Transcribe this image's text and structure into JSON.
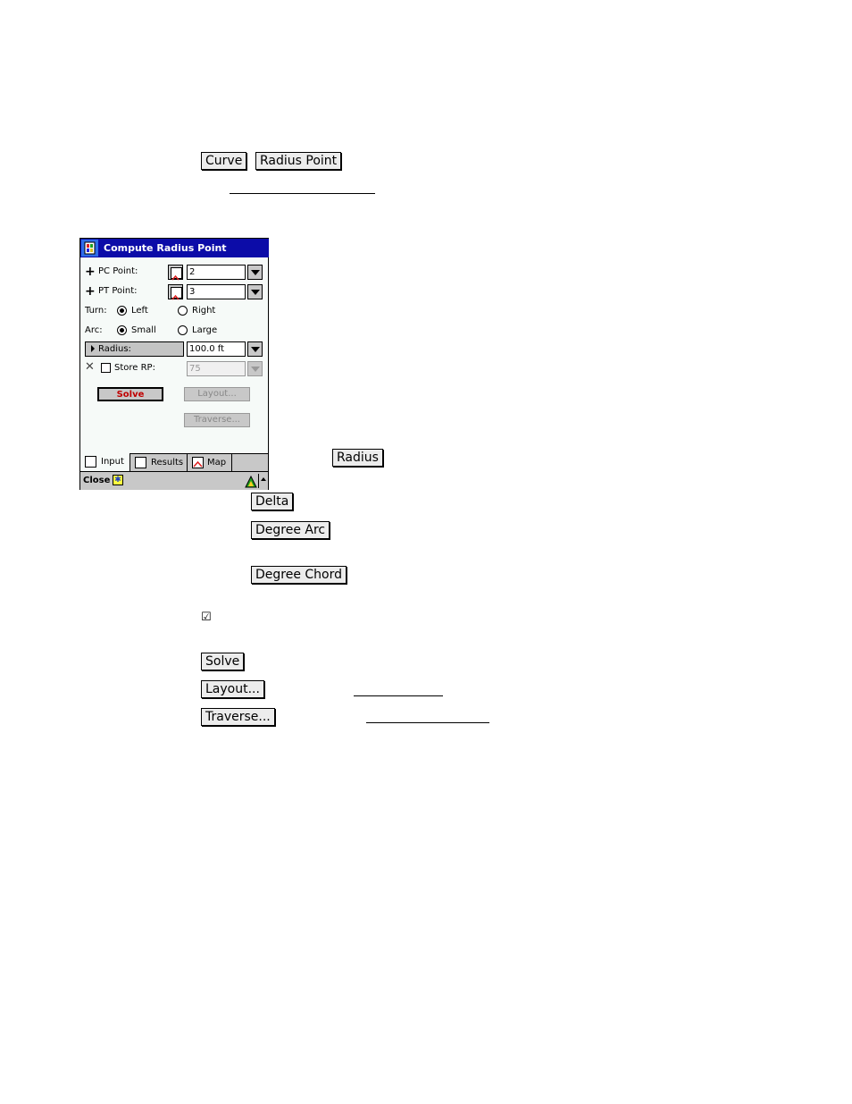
{
  "doc": {
    "inline_buttons": {
      "curve": "Curve",
      "radius_point": "Radius Point",
      "radius": "Radius",
      "delta": "Delta",
      "degree_arc": "Degree Arc",
      "degree_chord": "Degree Chord",
      "solve": "Solve",
      "layout": "Layout...",
      "traverse": "Traverse..."
    },
    "checkbox_glyph": "☑"
  },
  "dialog": {
    "title": "Compute Radius Point",
    "pc_point": {
      "label": "PC Point:",
      "value": "2"
    },
    "pt_point": {
      "label": "PT Point:",
      "value": "3"
    },
    "turn": {
      "label": "Turn:",
      "options": [
        "Left",
        "Right"
      ],
      "selected": "Left"
    },
    "arc": {
      "label": "Arc:",
      "options": [
        "Small",
        "Large"
      ],
      "selected": "Small"
    },
    "radius": {
      "label": "Radius:",
      "value": "100.0 ft"
    },
    "store_rp": {
      "label": "Store RP:",
      "checked": false,
      "value": "75"
    },
    "buttons": {
      "solve": "Solve",
      "layout": "Layout...",
      "traverse": "Traverse..."
    },
    "tabs": [
      {
        "label": "Input",
        "icon": "input-form-icon",
        "active": true
      },
      {
        "label": "Results",
        "icon": "results-doc-icon",
        "active": false
      },
      {
        "label": "Map",
        "icon": "map-icon",
        "active": false
      }
    ],
    "cmdbar": {
      "close": "Close"
    },
    "colors": {
      "titlebar": "#0c0ca8",
      "solve_text": "#c00000",
      "body": "#f6faf8",
      "chrome": "#c8c8c8"
    }
  }
}
